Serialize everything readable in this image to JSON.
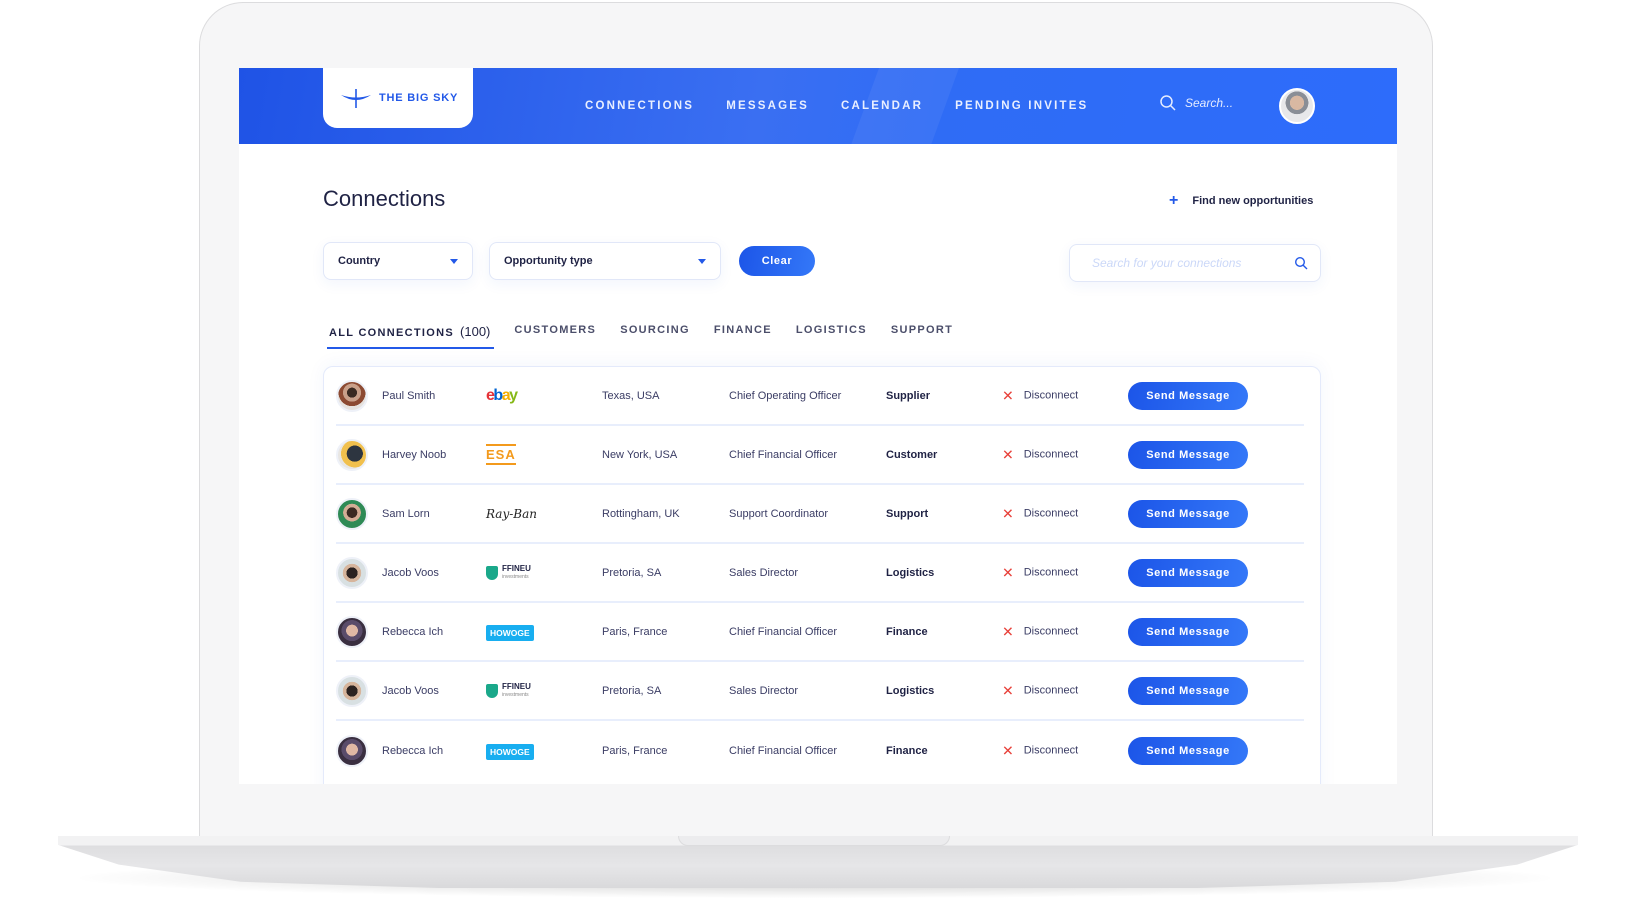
{
  "brand": {
    "name": "THE BIG SKY"
  },
  "nav": {
    "items": [
      "CONNECTIONS",
      "MESSAGES",
      "CALENDAR",
      "PENDING INVITES"
    ],
    "search_placeholder": "Search..."
  },
  "page": {
    "title": "Connections",
    "find_link": "Find new opportunities"
  },
  "filters": {
    "country": "Country",
    "opportunity_type": "Opportunity type",
    "clear_label": "Clear",
    "search_placeholder": "Search for your connections"
  },
  "tabs": [
    {
      "label": "ALL CONNECTIONS",
      "count": "(100)",
      "active": true
    },
    {
      "label": "CUSTOMERS"
    },
    {
      "label": "SOURCING"
    },
    {
      "label": "FINANCE"
    },
    {
      "label": "LOGISTICS"
    },
    {
      "label": "SUPPORT"
    }
  ],
  "colors": {
    "accent": "#2359e8",
    "disconnect": "#e8413a",
    "text_dark": "#1f2244"
  },
  "rows": [
    {
      "name": "Paul Smith",
      "company": "ebay",
      "location": "Texas, USA",
      "title": "Chief Operating Officer",
      "type": "Supplier",
      "disconnect": "Disconnect",
      "action": "Send Message"
    },
    {
      "name": "Harvey Noob",
      "company": "esa",
      "location": "New York, USA",
      "title": "Chief Financial Officer",
      "type": "Customer",
      "disconnect": "Disconnect",
      "action": "Send Message"
    },
    {
      "name": "Sam Lorn",
      "company": "Ray-Ban",
      "location": "Rottingham, UK",
      "title": "Support Coordinator",
      "type": "Support",
      "disconnect": "Disconnect",
      "action": "Send Message"
    },
    {
      "name": "Jacob Voos",
      "company": "FFINEU",
      "location": "Pretoria, SA",
      "title": "Sales Director",
      "type": "Logistics",
      "disconnect": "Disconnect",
      "action": "Send Message"
    },
    {
      "name": "Rebecca Ich",
      "company": "HOWOGE",
      "location": "Paris, France",
      "title": "Chief Financial Officer",
      "type": "Finance",
      "disconnect": "Disconnect",
      "action": "Send Message"
    },
    {
      "name": "Jacob Voos",
      "company": "FFINEU",
      "location": "Pretoria, SA",
      "title": "Sales Director",
      "type": "Logistics",
      "disconnect": "Disconnect",
      "action": "Send Message"
    },
    {
      "name": "Rebecca Ich",
      "company": "HOWOGE",
      "location": "Paris, France",
      "title": "Chief Financial Officer",
      "type": "Finance",
      "disconnect": "Disconnect",
      "action": "Send Message"
    }
  ],
  "logo_text": {
    "ffineu_sub": "investments"
  }
}
